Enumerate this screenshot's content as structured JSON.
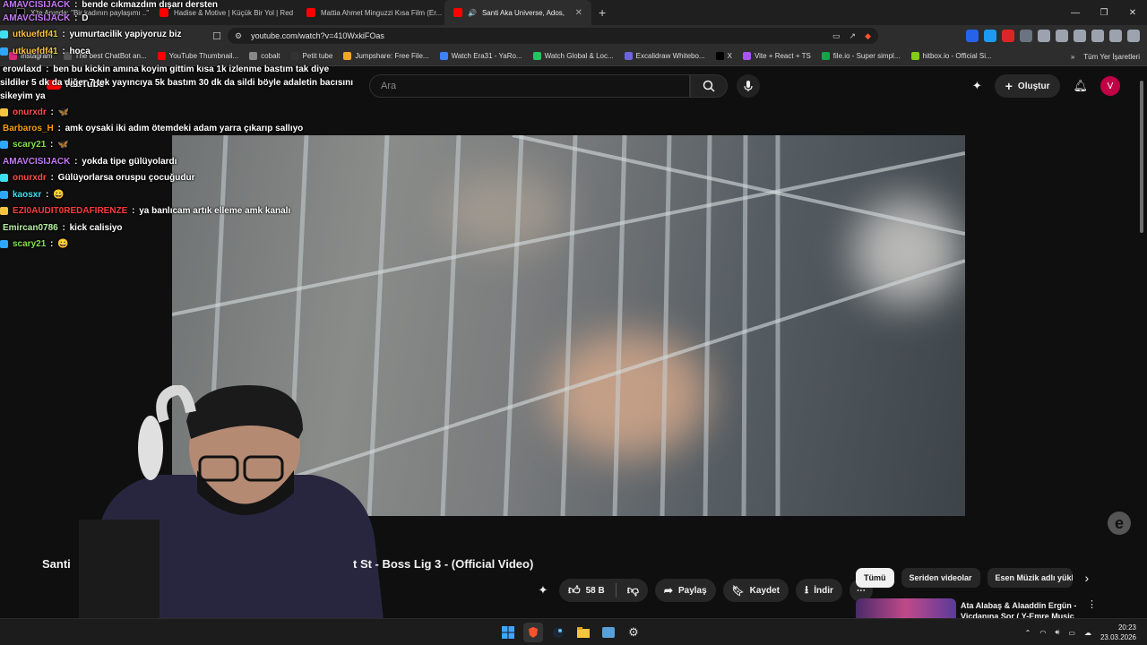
{
  "browser": {
    "tabs": [
      {
        "label": "X'te Anında: \"Bir kadının paylaşımı ..\"",
        "color": "#e0e0e0"
      },
      {
        "label": "Hadise & Motive | Küçük Bir Yol | Red",
        "color": "#ff0000"
      },
      {
        "label": "Mattia Ahmet Minguzzi Kısa Film (Er...",
        "color": "#ff0000"
      },
      {
        "label": "Santi Aka Universe, Ados, At...",
        "color": "#ff0000"
      }
    ],
    "url": "youtube.com/watch?v=410WxkiFOas",
    "bookmarks": [
      {
        "label": "Instagram",
        "color": "#d62976"
      },
      {
        "label": "The best ChatBot an...",
        "color": "#555"
      },
      {
        "label": "YouTube Thumbnail...",
        "color": "#ff0000"
      },
      {
        "label": "cobalt",
        "color": "#888"
      },
      {
        "label": "Petit tube",
        "color": "#333"
      },
      {
        "label": "Jumpshare: Free File...",
        "color": "#f5a623"
      },
      {
        "label": "Watch Era31 - YaRo...",
        "color": "#3b82f6"
      },
      {
        "label": "Watch Global & Loc...",
        "color": "#22c55e"
      },
      {
        "label": "Excalidraw Whitebo...",
        "color": "#6965db"
      },
      {
        "label": "X",
        "color": "#000"
      },
      {
        "label": "Vite + React + TS",
        "color": "#a855f7"
      },
      {
        "label": "file.io - Super simpl...",
        "color": "#16a34a"
      },
      {
        "label": "hitbox.io - Official Si...",
        "color": "#84cc16"
      }
    ],
    "bookmarks_more": "»",
    "bookmarks_all": "Tüm Yer İşaretleri"
  },
  "youtube": {
    "logo": "YouTube",
    "search_placeholder": "Ara",
    "create_label": "Oluştur",
    "avatar_letter": "V",
    "title_left": "Santi",
    "title_right": "t St - Boss Lig 3 - (Official Video)",
    "likes": "58 B",
    "share": "Paylaş",
    "save": "Kaydet",
    "download": "İndir",
    "chips": [
      "Tümü",
      "Seriden videolar",
      "Esen Müzik adlı yükle"
    ],
    "rec_title": "Ata Alabaş & Alaaddin Ergün - Vicdanına Sor ( Y-Emre Music"
  },
  "chat": [
    {
      "user": "AMAVCISIJACK",
      "msg": "bende cıkmazdım dışarı dersten",
      "color": "#c779f5"
    },
    {
      "user": "AMAVCISIJACK",
      "msg": "D",
      "color": "#c779f5"
    },
    {
      "user": "utkuefdf41",
      "msg": "yumurtacilik yapiyoruz biz",
      "color": "#f5c542"
    },
    {
      "user": "utkuefdf41",
      "msg": "hoca",
      "color": "#f5c542"
    },
    {
      "user": "erowlaxd",
      "msg": "ben bu kickin amına koyim gittim kısa 1k izlenme bastım tak diye",
      "color": "#ffffff"
    },
    {
      "user": "",
      "msg": "sildiler 5 dk da diğer 7 tek yayıncıya 5k bastım 30 dk da sildi böyle adaletin bacısını",
      "color": "#ffffff"
    },
    {
      "user": "",
      "msg": "sikeyim ya",
      "color": "#ffffff"
    },
    {
      "user": "onurxdr",
      "msg": "🦋",
      "color": "#ff4d4d"
    },
    {
      "user": "Barbaros_H",
      "msg": "amk oysaki iki adım ötemdeki adam yarra çıkarıp sallıyo",
      "color": "#f59e0b"
    },
    {
      "user": "scary21",
      "msg": "🦋",
      "color": "#84e04a"
    },
    {
      "user": "AMAVCISIJACK",
      "msg": "yokda tipe gülüyolardı",
      "color": "#c779f5"
    },
    {
      "user": "onurxdr",
      "msg": "Gülüyorlarsa oruspu çocuğudur",
      "color": "#ff4d4d"
    },
    {
      "user": "kaosxr",
      "msg": "😀",
      "color": "#3ee0f0"
    },
    {
      "user": "EZI0AUDIT0REDAFIRENZE",
      "msg": "ya banlıcam artık elleme amk kanalı",
      "color": "#ff3b3b"
    },
    {
      "user": "Emircan0786",
      "msg": "kick calisiyo",
      "color": "#b4f0a0"
    },
    {
      "user": "scary21",
      "msg": "😀",
      "color": "#84e04a"
    }
  ],
  "taskbar": {
    "time": "20:23",
    "date": "23.03.2026"
  }
}
